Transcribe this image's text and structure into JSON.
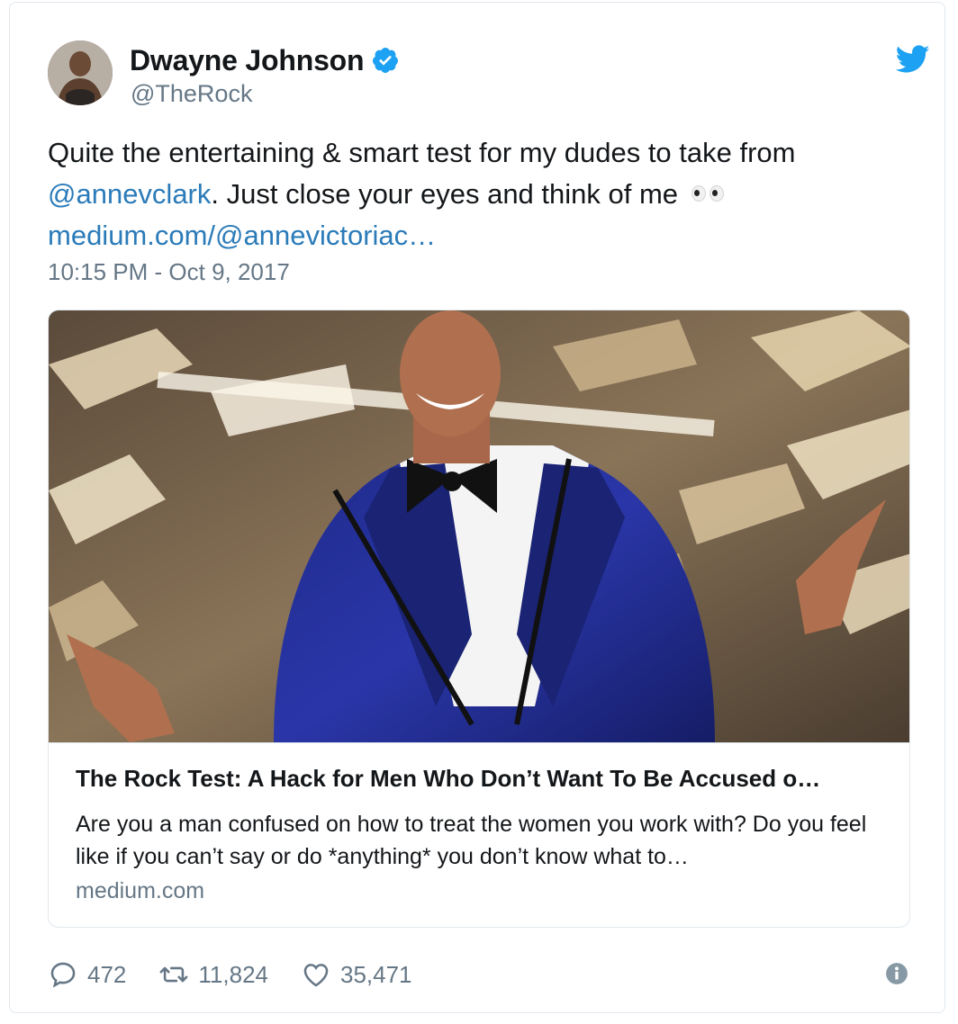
{
  "author": {
    "name": "Dwayne Johnson",
    "handle": "@TheRock",
    "verified": true
  },
  "tweet": {
    "text_before_mention": "Quite the entertaining & smart test for my dudes to take from",
    "mention": "@annevclark",
    "text_after_mention": ". Just close your eyes and think of me",
    "link": "medium.com/@annevictoriac…",
    "timestamp": "10:15 PM - Oct 9, 2017"
  },
  "card": {
    "title": "The Rock Test: A Hack for Men Who Don’t Want To Be Accused o…",
    "description": "Are you a man confused on how to treat the women you work with? Do you feel like if you can’t say or do *anything* you don’t know what to…",
    "domain": "medium.com"
  },
  "actions": {
    "replies": "472",
    "retweets": "11,824",
    "likes": "35,471"
  },
  "colors": {
    "link": "#2b7bb9",
    "muted": "#657786",
    "twitter_blue": "#1da1f2",
    "border": "#e1e8ed"
  },
  "icons": [
    "verified-badge-icon",
    "twitter-bird-icon",
    "reply-icon",
    "retweet-icon",
    "like-icon",
    "info-icon",
    "eyes-emoji-icon"
  ]
}
